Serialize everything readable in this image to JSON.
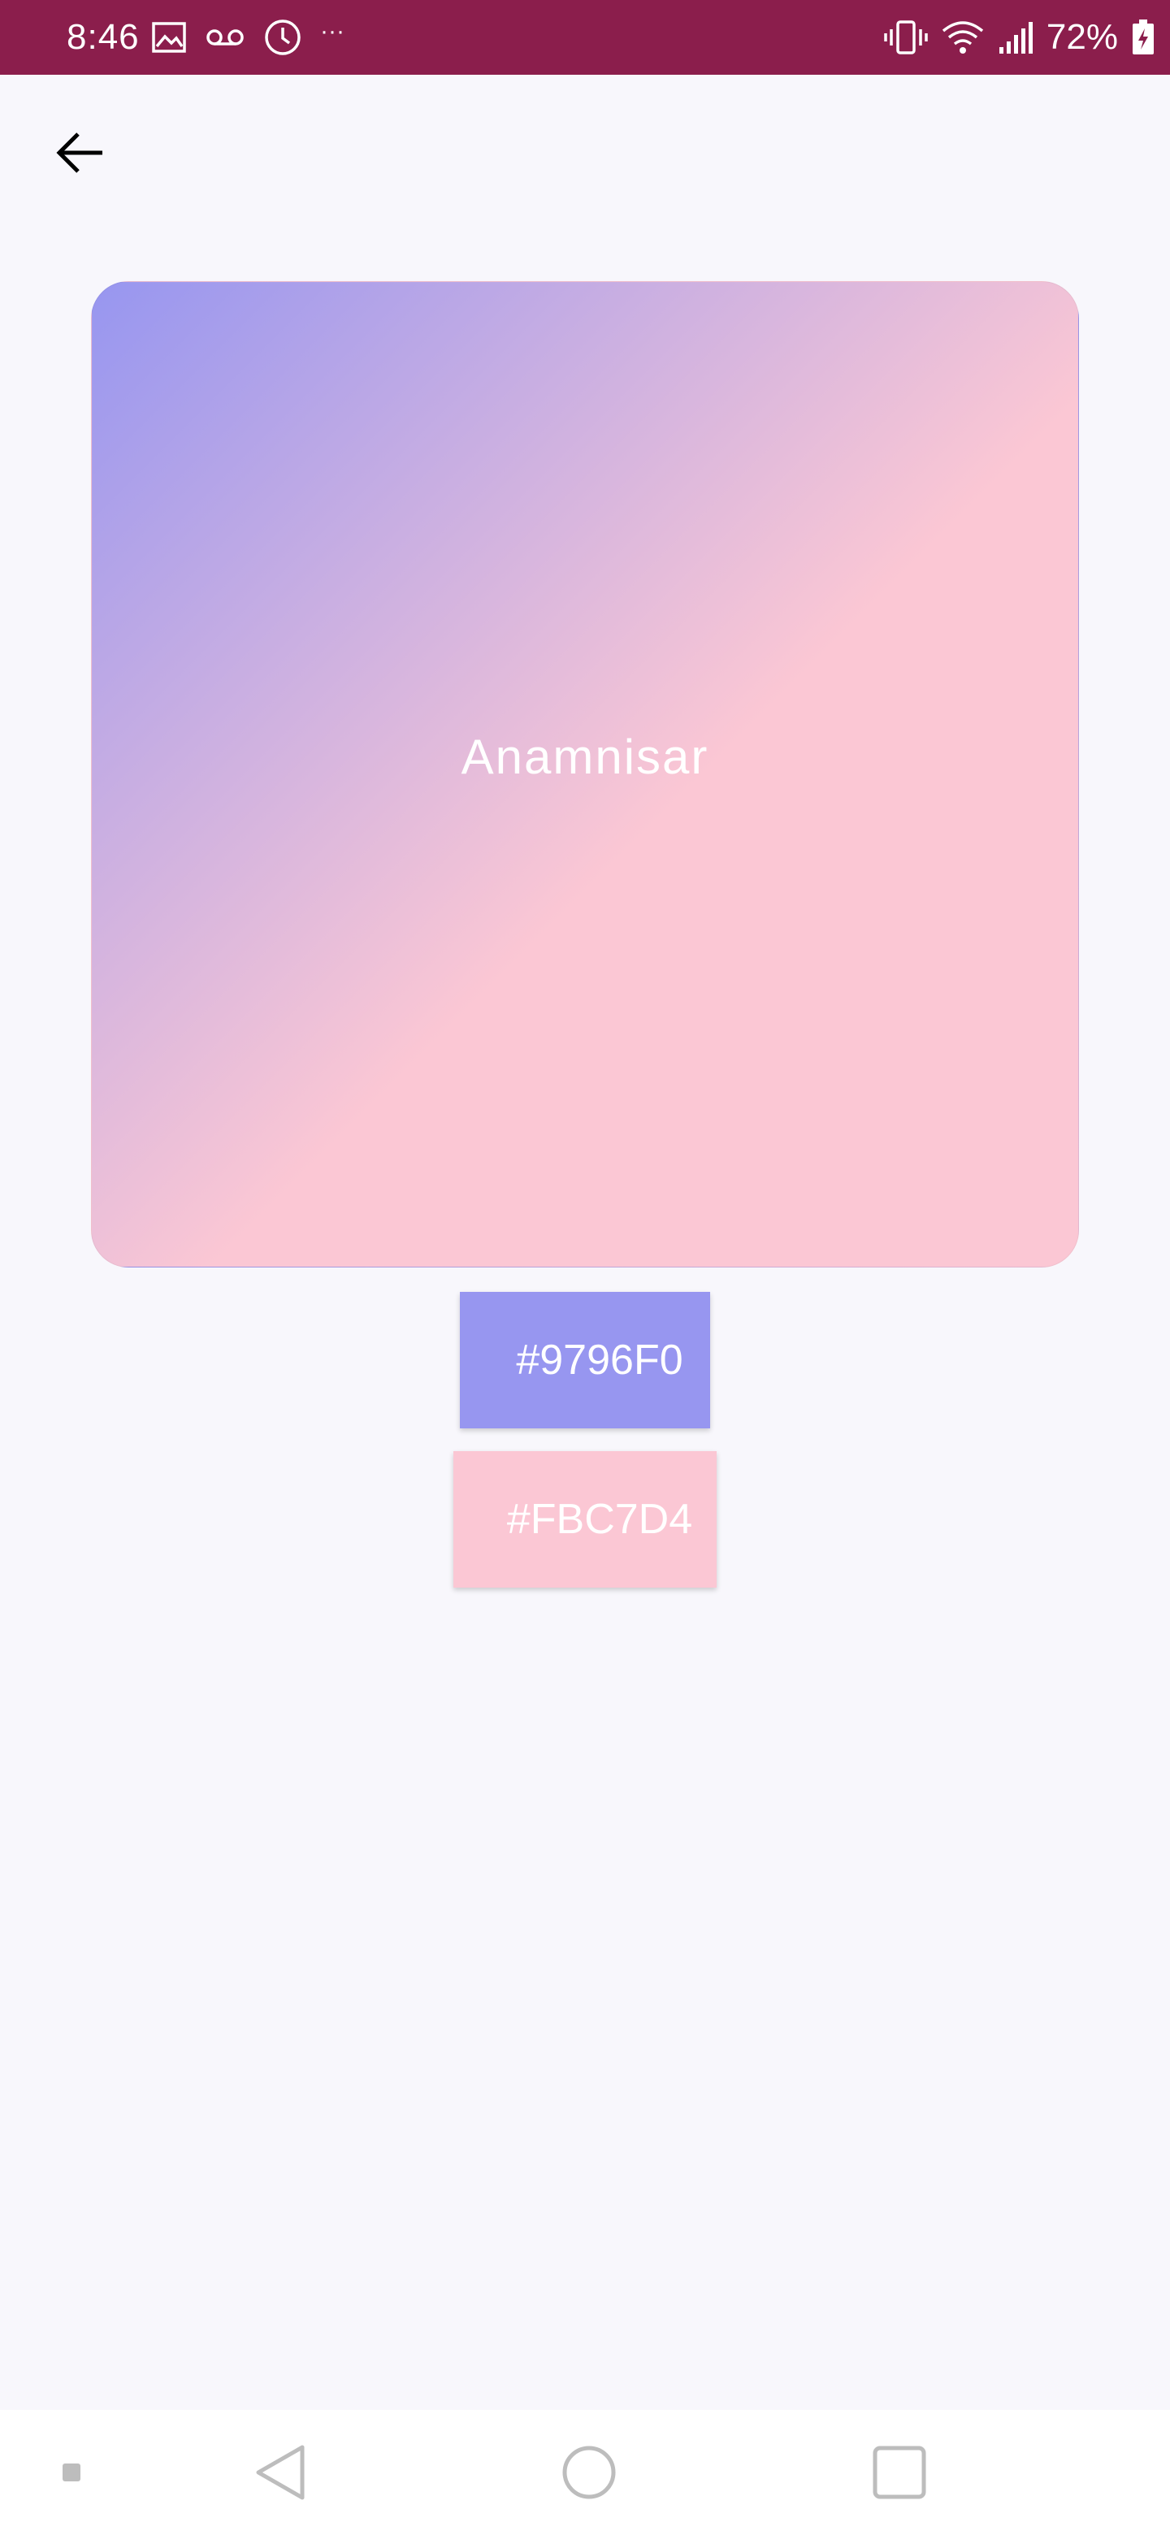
{
  "status_bar": {
    "time": "8:46",
    "notification_icons": [
      "image-icon",
      "voicemail-icon",
      "clock-icon"
    ],
    "overflow": "···",
    "system_icons": [
      "vibrate-icon",
      "wifi-icon",
      "signal-icon",
      "battery-charging-icon"
    ],
    "battery_percent": "72%",
    "background_color": "#8B1E4C"
  },
  "app_bar": {
    "back_icon": "arrow-back-icon"
  },
  "gradient": {
    "name": "Anamnisar",
    "colors": [
      "#9796F0",
      "#FBC7D4"
    ]
  },
  "chips": [
    {
      "label": "#9796F0",
      "color": "#9796F0"
    },
    {
      "label": "#FBC7D4",
      "color": "#FBC7D4"
    }
  ],
  "nav_bar": {
    "items": [
      "recents-dot-icon",
      "back-triangle-icon",
      "home-circle-icon",
      "overview-square-icon"
    ]
  }
}
